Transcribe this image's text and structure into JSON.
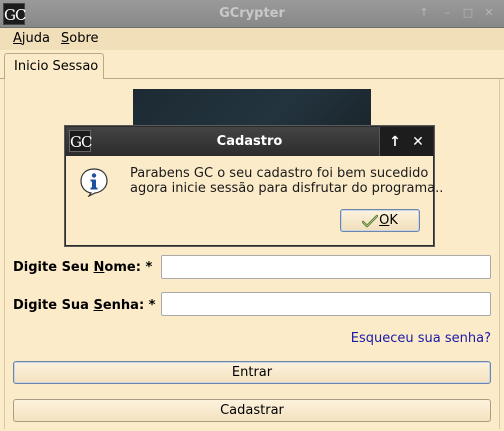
{
  "window": {
    "logo_text": "GC",
    "title": "GCrypter"
  },
  "menu": {
    "help_first": "A",
    "help_rest": "juda",
    "about_first": "S",
    "about_rest": "obre"
  },
  "tabs": [
    {
      "label": "Inicio Sessao",
      "active": true
    }
  ],
  "form": {
    "name_label_before": "Digite Seu ",
    "name_label_accel": "N",
    "name_label_after": "ome: *",
    "name_value": "",
    "password_label_before": "Digite Sua ",
    "password_label_accel": "S",
    "password_label_after": "enha: *",
    "password_value": "",
    "forgot_link": "Esqueceu sua senha?",
    "login_button": "Entrar",
    "register_button": "Cadastrar"
  },
  "dialog": {
    "logo_text": "GC",
    "title": "Cadastro",
    "message_line1": "Parabens GC o seu cadastro foi bem sucedido",
    "message_line2": "agora inicie sessão para disfrutar do programa..",
    "ok_accel": "O",
    "ok_rest": "K"
  },
  "colors": {
    "background": "#fbebc9",
    "menubar": "#f1dfb9",
    "link": "#1a1aa6",
    "dialog_titlebar": "#2c2c2c"
  },
  "icons": {
    "dialog_icon": "info-icon",
    "ok_icon": "check-icon"
  }
}
